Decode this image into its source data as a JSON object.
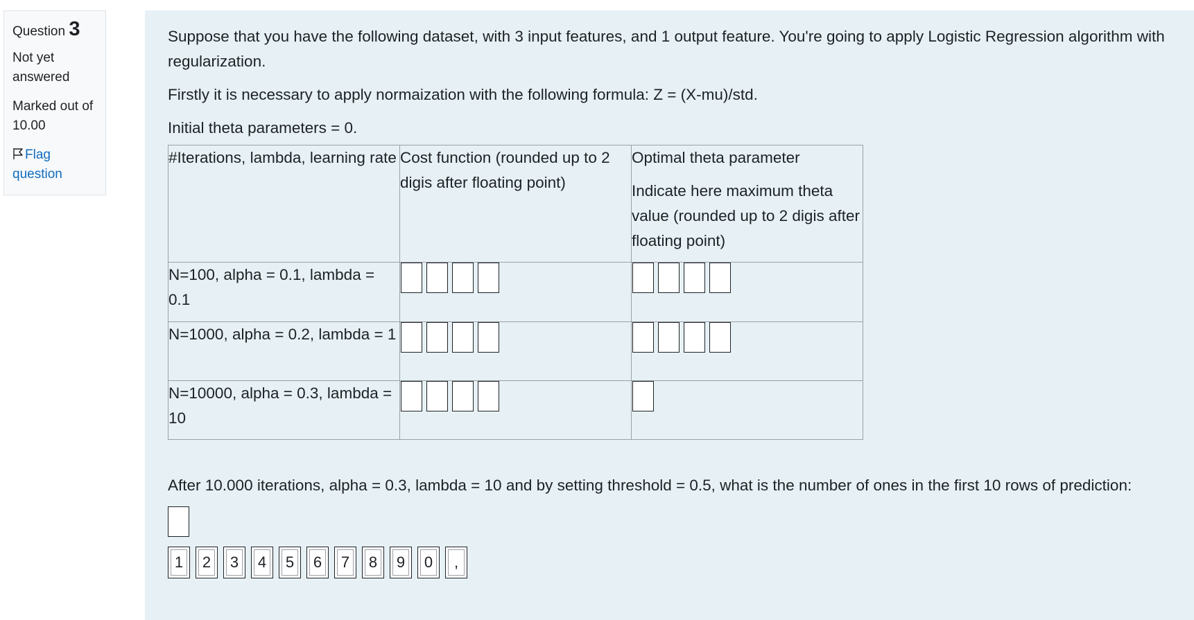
{
  "info": {
    "question_label": "Question",
    "question_number": "3",
    "state_line1": "Not yet",
    "state_line2": "answered",
    "grade_line1": "Marked out of",
    "grade_line2": "10.00",
    "flag_line1": "Flag",
    "flag_line2": "question",
    "flag_icon": "flag-outline-icon"
  },
  "question": {
    "intro": "Suppose that you have the following dataset, with 3 input features, and 1 output feature. You're going to apply Logistic Regression algorithm with regularization.",
    "normalization": "Firstly it is necessary to apply normaization with the following formula: Z = (X-mu)/std.",
    "initial_theta": "Initial theta parameters = 0.",
    "table": {
      "headers": [
        "#Iterations, lambda, learning rate",
        "Cost function (rounded up to 2 digis after floating point)",
        "Optimal theta parameter"
      ],
      "header3_sub": "Indicate here maximum theta value (rounded up to 2 digis after floating point)",
      "rows": [
        {
          "label": "N=100, alpha = 0.1, lambda = 0.1",
          "cost_boxes": 4,
          "theta_boxes": 4
        },
        {
          "label": "N=1000, alpha = 0.2, lambda = 1",
          "cost_boxes": 4,
          "theta_boxes": 4
        },
        {
          "label": "N=10000, alpha = 0.3, lambda = 10",
          "cost_boxes": 4,
          "theta_boxes": 1
        }
      ]
    },
    "after": "After 10.000 iterations, alpha = 0.3, lambda = 10  and by setting threshold = 0.5, what is the number of ones in the first 10 rows of prediction:",
    "keypad": [
      "1",
      "2",
      "3",
      "4",
      "5",
      "6",
      "7",
      "8",
      "9",
      "0",
      ","
    ]
  }
}
